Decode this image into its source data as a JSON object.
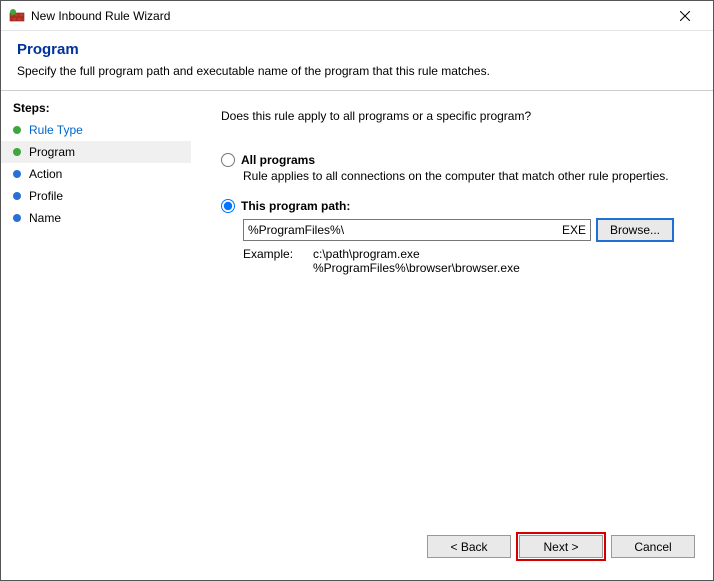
{
  "window": {
    "title": "New Inbound Rule Wizard"
  },
  "header": {
    "title": "Program",
    "subtitle": "Specify the full program path and executable name of the program that this rule matches."
  },
  "sidebar": {
    "title": "Steps:",
    "items": [
      {
        "label": "Rule Type"
      },
      {
        "label": "Program"
      },
      {
        "label": "Action"
      },
      {
        "label": "Profile"
      },
      {
        "label": "Name"
      }
    ]
  },
  "content": {
    "question": "Does this rule apply to all programs or a specific program?",
    "opt_all": {
      "label": "All programs",
      "desc": "Rule applies to all connections on the computer that match other rule properties."
    },
    "opt_path": {
      "label": "This program path:",
      "value": "%ProgramFiles%\\",
      "ext": "EXE",
      "browse": "Browse...",
      "example_label": "Example:",
      "example1": "c:\\path\\program.exe",
      "example2": "%ProgramFiles%\\browser\\browser.exe"
    }
  },
  "footer": {
    "back": "< Back",
    "next": "Next >",
    "cancel": "Cancel"
  }
}
